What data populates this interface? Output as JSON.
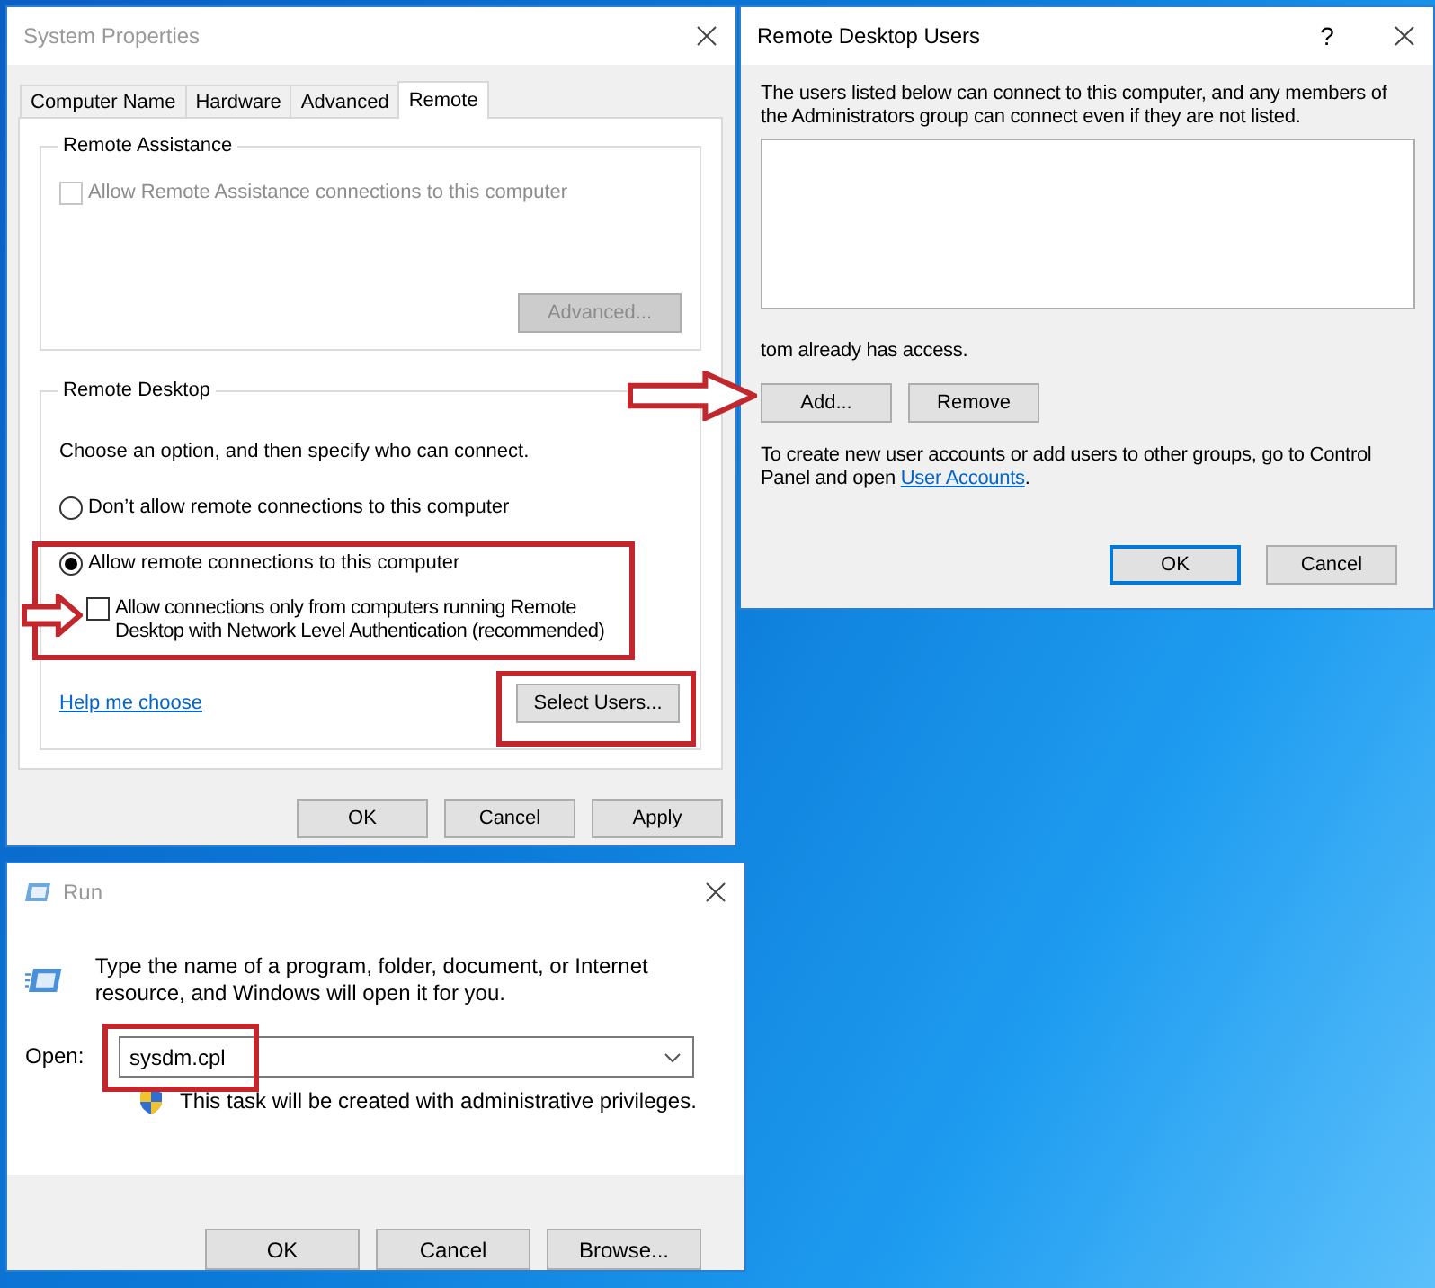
{
  "system_properties": {
    "title": "System Properties",
    "active": false,
    "tabs": [
      {
        "label": "Computer Name",
        "selected": false
      },
      {
        "label": "Hardware",
        "selected": false
      },
      {
        "label": "Advanced",
        "selected": false
      },
      {
        "label": "Remote",
        "selected": true
      }
    ],
    "remote_assistance": {
      "legend": "Remote Assistance",
      "checkbox": {
        "label": "Allow Remote Assistance connections to this computer",
        "checked": false,
        "disabled": true
      },
      "advanced_button": {
        "label": "Advanced...",
        "disabled": true
      }
    },
    "remote_desktop": {
      "legend": "Remote Desktop",
      "instruction": "Choose an option, and then specify who can connect.",
      "options": [
        {
          "label": "Don’t allow remote connections to this computer",
          "selected": false
        },
        {
          "label": "Allow remote connections to this computer",
          "selected": true
        }
      ],
      "nla_checkbox": {
        "label": "Allow connections only from computers running Remote Desktop with Network Level Authentication (recommended)",
        "checked": false
      },
      "help_link": "Help me choose",
      "select_users_button": "Select Users..."
    },
    "buttons": [
      "OK",
      "Cancel",
      "Apply"
    ]
  },
  "remote_desktop_users": {
    "title": "Remote Desktop Users",
    "active": true,
    "help_glyph": "?",
    "description": "The users listed below can connect to this computer, and any members of the Administrators group can connect even if they are not listed.",
    "status": "tom already has access.",
    "buttons": [
      "Add...",
      "Remove"
    ],
    "footer_text": "To create new user accounts or add users to other groups, go to Control Panel and open ",
    "footer_link": "User Accounts",
    "footer_end": ".",
    "dialog_buttons": [
      {
        "label": "OK",
        "default": true
      },
      {
        "label": "Cancel",
        "default": false
      }
    ]
  },
  "run": {
    "title": "Run",
    "active": false,
    "description": "Type the name of a program, folder, document, or Internet resource, and Windows will open it for you.",
    "open_label": "Open:",
    "open_value": "sysdm.cpl",
    "uac_note": "This task will be created with administrative privileges.",
    "buttons": [
      "OK",
      "Cancel",
      "Browse..."
    ]
  }
}
